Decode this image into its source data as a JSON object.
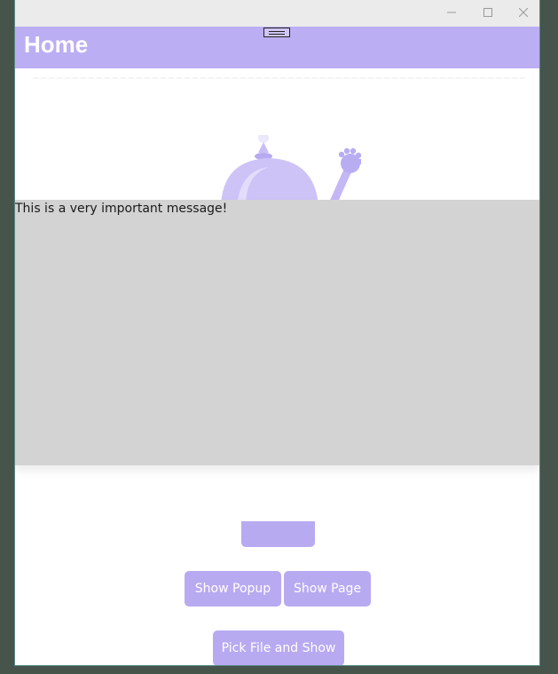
{
  "window": {
    "caption_buttons": {
      "minimize_icon": "minimize-icon",
      "maximize_icon": "maximize-icon",
      "close_icon": "close-icon"
    }
  },
  "appbar": {
    "title": "Home",
    "background": "#bbaef3"
  },
  "popup": {
    "message": "This is a very important message!",
    "background": "#d3d3d3"
  },
  "buttons": {
    "show_popup": "Show Popup",
    "show_page": "Show Page",
    "pick_file": "Pick File and Show",
    "accent": "#b8aaf1"
  },
  "illustration": {
    "icon": "waving-bot-illustration"
  }
}
